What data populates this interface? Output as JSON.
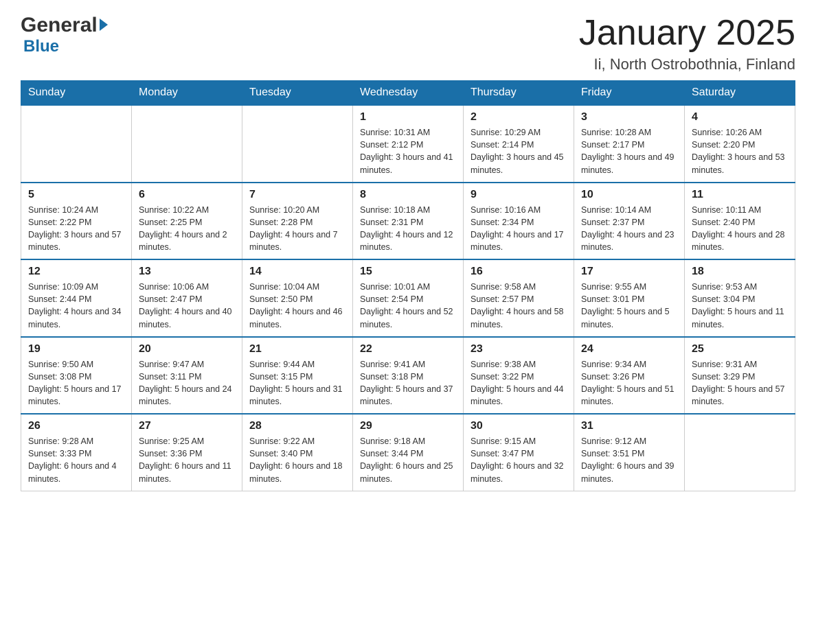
{
  "header": {
    "logo": {
      "general": "General",
      "blue": "Blue",
      "arrow": "▶"
    },
    "title": "January 2025",
    "location": "Ii, North Ostrobothnia, Finland"
  },
  "weekdays": [
    "Sunday",
    "Monday",
    "Tuesday",
    "Wednesday",
    "Thursday",
    "Friday",
    "Saturday"
  ],
  "weeks": [
    [
      {
        "day": "",
        "info": ""
      },
      {
        "day": "",
        "info": ""
      },
      {
        "day": "",
        "info": ""
      },
      {
        "day": "1",
        "info": "Sunrise: 10:31 AM\nSunset: 2:12 PM\nDaylight: 3 hours\nand 41 minutes."
      },
      {
        "day": "2",
        "info": "Sunrise: 10:29 AM\nSunset: 2:14 PM\nDaylight: 3 hours\nand 45 minutes."
      },
      {
        "day": "3",
        "info": "Sunrise: 10:28 AM\nSunset: 2:17 PM\nDaylight: 3 hours\nand 49 minutes."
      },
      {
        "day": "4",
        "info": "Sunrise: 10:26 AM\nSunset: 2:20 PM\nDaylight: 3 hours\nand 53 minutes."
      }
    ],
    [
      {
        "day": "5",
        "info": "Sunrise: 10:24 AM\nSunset: 2:22 PM\nDaylight: 3 hours\nand 57 minutes."
      },
      {
        "day": "6",
        "info": "Sunrise: 10:22 AM\nSunset: 2:25 PM\nDaylight: 4 hours\nand 2 minutes."
      },
      {
        "day": "7",
        "info": "Sunrise: 10:20 AM\nSunset: 2:28 PM\nDaylight: 4 hours\nand 7 minutes."
      },
      {
        "day": "8",
        "info": "Sunrise: 10:18 AM\nSunset: 2:31 PM\nDaylight: 4 hours\nand 12 minutes."
      },
      {
        "day": "9",
        "info": "Sunrise: 10:16 AM\nSunset: 2:34 PM\nDaylight: 4 hours\nand 17 minutes."
      },
      {
        "day": "10",
        "info": "Sunrise: 10:14 AM\nSunset: 2:37 PM\nDaylight: 4 hours\nand 23 minutes."
      },
      {
        "day": "11",
        "info": "Sunrise: 10:11 AM\nSunset: 2:40 PM\nDaylight: 4 hours\nand 28 minutes."
      }
    ],
    [
      {
        "day": "12",
        "info": "Sunrise: 10:09 AM\nSunset: 2:44 PM\nDaylight: 4 hours\nand 34 minutes."
      },
      {
        "day": "13",
        "info": "Sunrise: 10:06 AM\nSunset: 2:47 PM\nDaylight: 4 hours\nand 40 minutes."
      },
      {
        "day": "14",
        "info": "Sunrise: 10:04 AM\nSunset: 2:50 PM\nDaylight: 4 hours\nand 46 minutes."
      },
      {
        "day": "15",
        "info": "Sunrise: 10:01 AM\nSunset: 2:54 PM\nDaylight: 4 hours\nand 52 minutes."
      },
      {
        "day": "16",
        "info": "Sunrise: 9:58 AM\nSunset: 2:57 PM\nDaylight: 4 hours\nand 58 minutes."
      },
      {
        "day": "17",
        "info": "Sunrise: 9:55 AM\nSunset: 3:01 PM\nDaylight: 5 hours\nand 5 minutes."
      },
      {
        "day": "18",
        "info": "Sunrise: 9:53 AM\nSunset: 3:04 PM\nDaylight: 5 hours\nand 11 minutes."
      }
    ],
    [
      {
        "day": "19",
        "info": "Sunrise: 9:50 AM\nSunset: 3:08 PM\nDaylight: 5 hours\nand 17 minutes."
      },
      {
        "day": "20",
        "info": "Sunrise: 9:47 AM\nSunset: 3:11 PM\nDaylight: 5 hours\nand 24 minutes."
      },
      {
        "day": "21",
        "info": "Sunrise: 9:44 AM\nSunset: 3:15 PM\nDaylight: 5 hours\nand 31 minutes."
      },
      {
        "day": "22",
        "info": "Sunrise: 9:41 AM\nSunset: 3:18 PM\nDaylight: 5 hours\nand 37 minutes."
      },
      {
        "day": "23",
        "info": "Sunrise: 9:38 AM\nSunset: 3:22 PM\nDaylight: 5 hours\nand 44 minutes."
      },
      {
        "day": "24",
        "info": "Sunrise: 9:34 AM\nSunset: 3:26 PM\nDaylight: 5 hours\nand 51 minutes."
      },
      {
        "day": "25",
        "info": "Sunrise: 9:31 AM\nSunset: 3:29 PM\nDaylight: 5 hours\nand 57 minutes."
      }
    ],
    [
      {
        "day": "26",
        "info": "Sunrise: 9:28 AM\nSunset: 3:33 PM\nDaylight: 6 hours\nand 4 minutes."
      },
      {
        "day": "27",
        "info": "Sunrise: 9:25 AM\nSunset: 3:36 PM\nDaylight: 6 hours\nand 11 minutes."
      },
      {
        "day": "28",
        "info": "Sunrise: 9:22 AM\nSunset: 3:40 PM\nDaylight: 6 hours\nand 18 minutes."
      },
      {
        "day": "29",
        "info": "Sunrise: 9:18 AM\nSunset: 3:44 PM\nDaylight: 6 hours\nand 25 minutes."
      },
      {
        "day": "30",
        "info": "Sunrise: 9:15 AM\nSunset: 3:47 PM\nDaylight: 6 hours\nand 32 minutes."
      },
      {
        "day": "31",
        "info": "Sunrise: 9:12 AM\nSunset: 3:51 PM\nDaylight: 6 hours\nand 39 minutes."
      },
      {
        "day": "",
        "info": ""
      }
    ]
  ]
}
